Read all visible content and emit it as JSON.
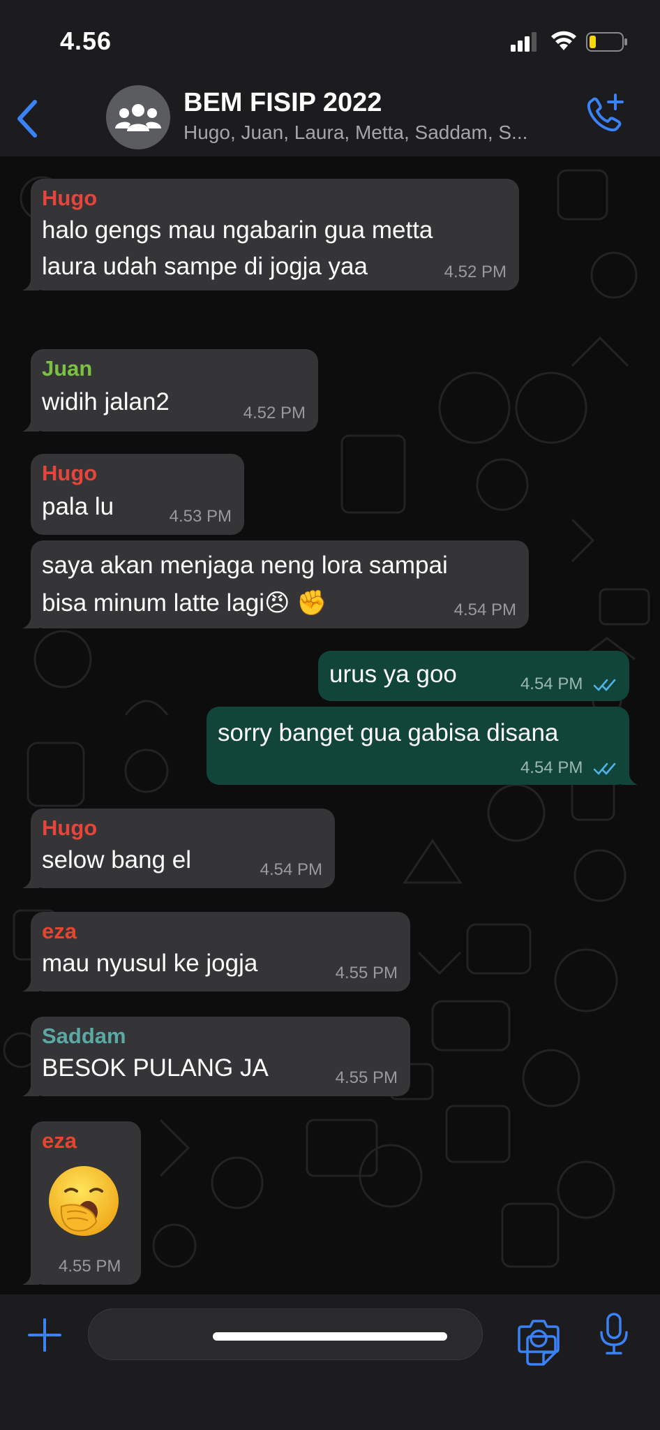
{
  "status_bar": {
    "time": "4.56"
  },
  "header": {
    "title": "BEM FISIP 2022",
    "subtitle": "Hugo, Juan, Laura, Metta, Saddam, S..."
  },
  "colors": {
    "accent": "#3b82f6",
    "incoming_bubble": "#353537",
    "outgoing_bubble": "#12453a",
    "sender_hugo": "#e5453a",
    "sender_juan": "#7cc242",
    "sender_eza": "#e8452e",
    "sender_saddam": "#5ba9a4"
  },
  "messages": [
    {
      "dir": "in",
      "sender": "Hugo",
      "lines": [
        "halo gengs mau ngabarin gua metta",
        "laura udah sampe di jogja yaa"
      ],
      "time": "4.52 PM"
    },
    {
      "dir": "in",
      "sender": "Juan",
      "lines": [
        "widih jalan2"
      ],
      "time": "4.52 PM"
    },
    {
      "dir": "in",
      "sender": "Hugo",
      "lines": [
        "pala lu"
      ],
      "time": "4.53 PM"
    },
    {
      "dir": "in",
      "sender": "",
      "lines": [
        "saya akan menjaga neng lora sampai",
        "bisa minum latte lagi😠 ✊"
      ],
      "time": "4.54 PM"
    },
    {
      "dir": "out",
      "lines": [
        "urus ya goo"
      ],
      "time": "4.54 PM",
      "status": "read"
    },
    {
      "dir": "out",
      "lines": [
        "sorry banget gua gabisa disana"
      ],
      "time": "4.54 PM",
      "status": "read"
    },
    {
      "dir": "in",
      "sender": "Hugo",
      "lines": [
        "selow bang el"
      ],
      "time": "4.54 PM"
    },
    {
      "dir": "in",
      "sender": "eza",
      "lines": [
        "mau nyusul ke jogja"
      ],
      "time": "4.55 PM"
    },
    {
      "dir": "in",
      "sender": "Saddam",
      "lines": [
        "BESOK PULANG JA"
      ],
      "time": "4.55 PM"
    },
    {
      "dir": "in",
      "sender": "eza",
      "emoji": "yawning-face-emoji",
      "time": "4.55 PM"
    }
  ],
  "composer": {
    "placeholder": ""
  }
}
